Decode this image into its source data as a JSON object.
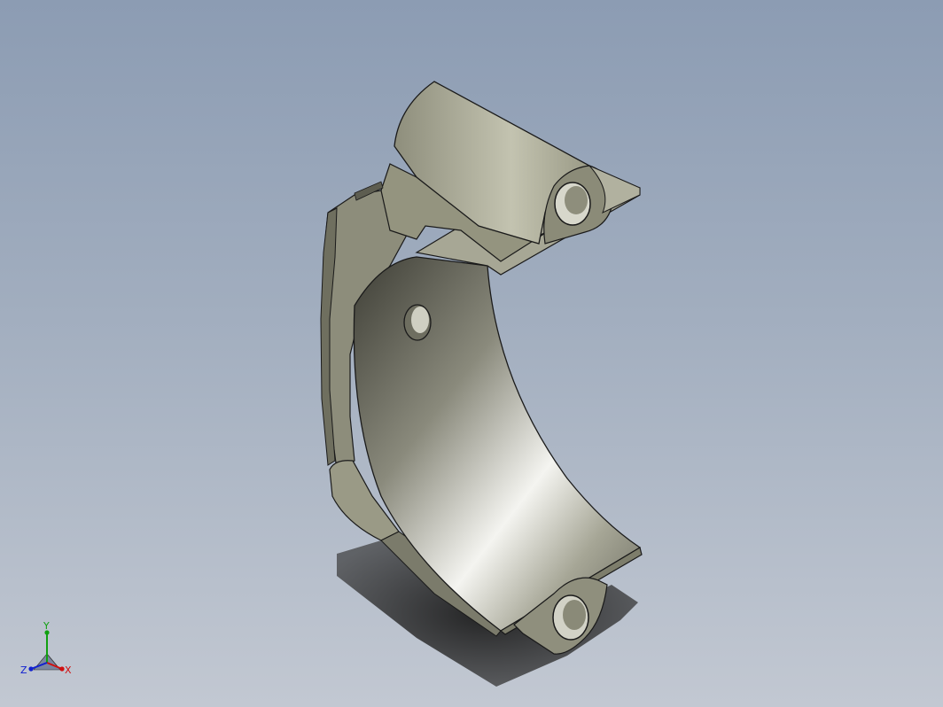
{
  "viewport": {
    "background_top": "#8c9cb3",
    "background_bottom": "#c2c8d2"
  },
  "model": {
    "part_color": "#9e9e88",
    "shadow_color": "#2a2a2a"
  },
  "triad": {
    "x_label": "X",
    "y_label": "Y",
    "z_label": "Z",
    "x_color": "#d01010",
    "y_color": "#10a010",
    "z_color": "#1020d0"
  }
}
